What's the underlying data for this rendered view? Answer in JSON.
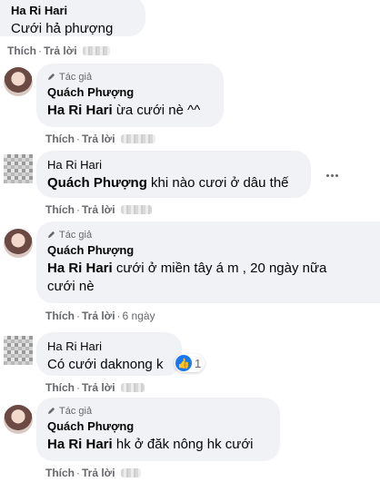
{
  "comments": [
    {
      "author": "Ha Ri Hari",
      "text": "Cưới hả phượng"
    },
    {
      "tag": "Tác giả",
      "author": "Quách Phượng",
      "mention": "Ha Ri Hari",
      "text": " ừa cưới nè ^^"
    },
    {
      "author": "Ha Ri Hari",
      "mention": "Quách Phượng",
      "text": " khi nào cươi ở dâu thế"
    },
    {
      "tag": "Tác giả",
      "author": "Quách Phượng",
      "mention": "Ha Ri Hari",
      "text": " cưới ở miền tây á m , 20 ngày nữa cưới nè"
    },
    {
      "author": "Ha Ri Hari",
      "text": "Có cưới daknong k",
      "reaction_count": "1"
    },
    {
      "tag": "Tác giả",
      "author": "Quách Phượng",
      "mention": "Ha Ri Hari",
      "text": " hk ở đăk nông hk cưới"
    }
  ],
  "actions": {
    "like": "Thích",
    "reply": "Trả lời",
    "separator": "·",
    "time_4": "6 ngày"
  },
  "icons": {
    "like": "like-icon",
    "pen": "pen-icon",
    "more": "more-options-icon"
  },
  "colors": {
    "bubble": "#f0f2f5",
    "meta": "#65676b",
    "like": "#1877f2"
  }
}
